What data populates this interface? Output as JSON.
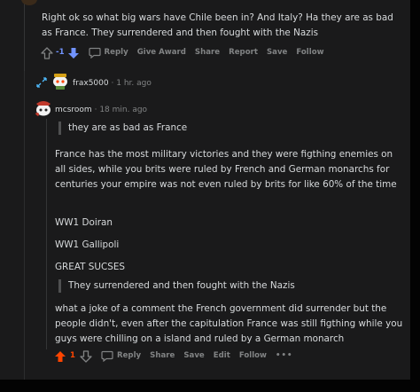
{
  "top_comment": {
    "text": "Right ok so what big wars have Chile been in? And Italy? Ha they are as bad as France. They surrendered and then fought with the Nazis",
    "score": "-1",
    "actions": [
      "Reply",
      "Give Award",
      "Share",
      "Report",
      "Save",
      "Follow"
    ]
  },
  "reply1": {
    "username": "frax5000",
    "separator": "·",
    "timestamp": "1 hr. ago"
  },
  "reply2": {
    "username": "mcsroom",
    "separator": "·",
    "timestamp": "18 min. ago",
    "quote1": "they are as bad as France",
    "paragraph1": "France has the most military victories and they were figthing enemies on all sides, while you brits were ruled by French and German monarchs for centuries your empire was not even ruled by brits for like 60% of the time",
    "line_ww1_doiran": "WW1 Doiran",
    "line_ww1_gallipoli": "WW1 Gallipoli",
    "line_great_sucses": "GREAT SUCSES",
    "quote2": "They surrendered and then fought with the Nazis",
    "paragraph2": "what a joke of a comment the French government did surrender but the people didn't, even after the capitulation France was still figthing while you guys were chilling on a island and ruled by a German monarch",
    "score": "1",
    "actions": [
      "Reply",
      "Share",
      "Save",
      "Edit",
      "Follow"
    ],
    "more": "•••"
  },
  "colors": {
    "background": "#1a1a1b",
    "text": "#d7dadc",
    "muted": "#818384",
    "upvote": "#ff4500",
    "downvote": "#7193ff"
  }
}
